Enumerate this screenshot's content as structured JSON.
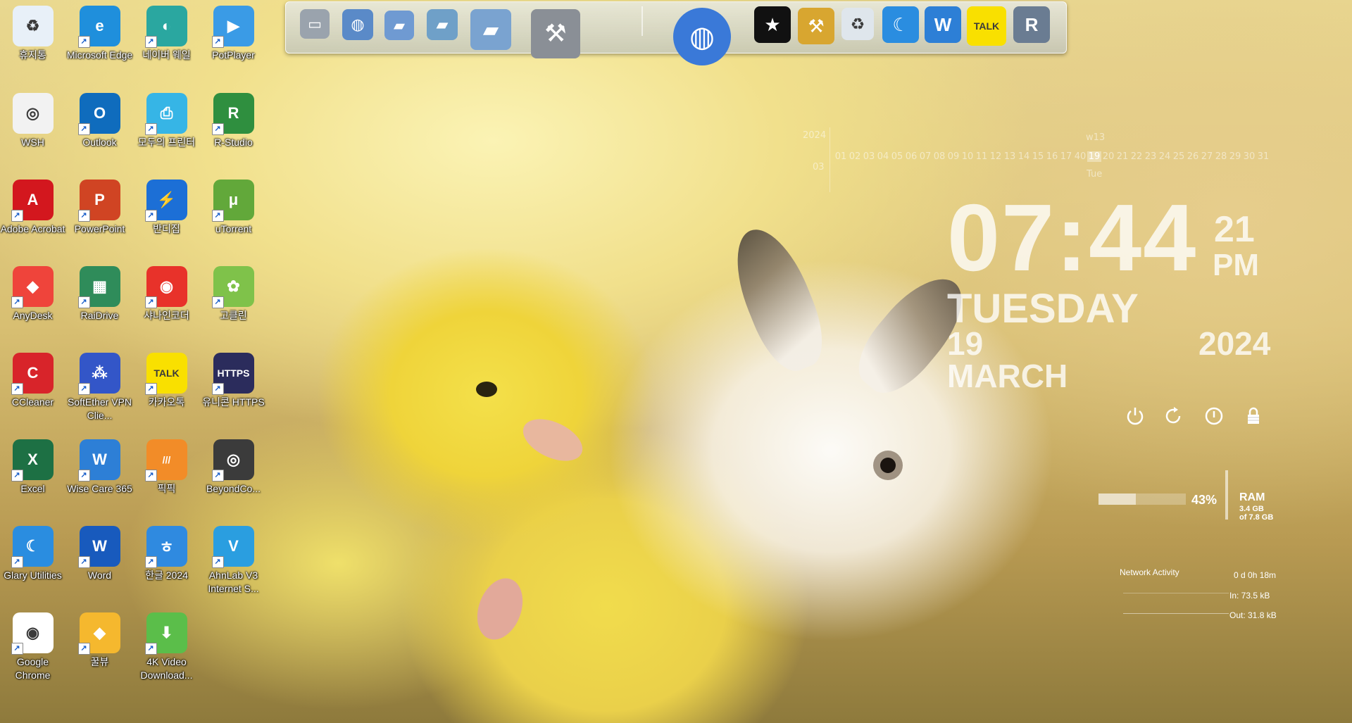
{
  "desktop": {
    "icons": [
      {
        "label": "휴지통",
        "icon": "recycle-bin-icon",
        "color": "#e8f0f8",
        "glyph": "♻"
      },
      {
        "label": "Microsoft Edge",
        "icon": "edge-icon",
        "color": "#1f8fdc",
        "glyph": "e"
      },
      {
        "label": "네이버 웨일",
        "icon": "naver-whale-icon",
        "color": "#2aa7a0",
        "glyph": "◐"
      },
      {
        "label": "PotPlayer",
        "icon": "potplayer-icon",
        "color": "#3a9be6",
        "glyph": "▶"
      },
      {
        "label": "WSH",
        "icon": "wsh-icon",
        "color": "#f2f2f2",
        "glyph": "◎"
      },
      {
        "label": "Outlook",
        "icon": "outlook-icon",
        "color": "#0f6cbd",
        "glyph": "O"
      },
      {
        "label": "모두의 프린터",
        "icon": "printer-icon",
        "color": "#36b5e6",
        "glyph": "⎙"
      },
      {
        "label": "R-Studio",
        "icon": "r-studio-icon",
        "color": "#2f8f3f",
        "glyph": "R"
      },
      {
        "label": "Adobe Acrobat",
        "icon": "acrobat-icon",
        "color": "#d3171e",
        "glyph": "A"
      },
      {
        "label": "PowerPoint",
        "icon": "powerpoint-icon",
        "color": "#d04423",
        "glyph": "P"
      },
      {
        "label": "반디집",
        "icon": "bandizip-icon",
        "color": "#1c6fd6",
        "glyph": "⚡"
      },
      {
        "label": "uTorrent",
        "icon": "utorrent-icon",
        "color": "#62a83a",
        "glyph": "μ"
      },
      {
        "label": "AnyDesk",
        "icon": "anydesk-icon",
        "color": "#ef443b",
        "glyph": "◆"
      },
      {
        "label": "RaiDrive",
        "icon": "raidrive-icon",
        "color": "#2f8c5a",
        "glyph": "▦"
      },
      {
        "label": "샤나인코더",
        "icon": "shana-encoder-icon",
        "color": "#e8322a",
        "glyph": "◉"
      },
      {
        "label": "고클린",
        "icon": "goclean-icon",
        "color": "#7fc24a",
        "glyph": "✿"
      },
      {
        "label": "CCleaner",
        "icon": "ccleaner-icon",
        "color": "#d8242a",
        "glyph": "C"
      },
      {
        "label": "SoftEther VPN Clie...",
        "icon": "softether-vpn-icon",
        "color": "#3356c8",
        "glyph": "⁂"
      },
      {
        "label": "카카오톡",
        "icon": "kakaotalk-icon",
        "color": "#f9e000",
        "glyph": "TALK"
      },
      {
        "label": "유니콘 HTTPS",
        "icon": "unicorn-https-icon",
        "color": "#2b2c5c",
        "glyph": "HTTPS"
      },
      {
        "label": "Excel",
        "icon": "excel-icon",
        "color": "#1d7044",
        "glyph": "X"
      },
      {
        "label": "Wise Care 365",
        "icon": "wise-care-icon",
        "color": "#2d7fd6",
        "glyph": "W"
      },
      {
        "label": "픽픽",
        "icon": "picpick-icon",
        "color": "#f28c28",
        "glyph": "///"
      },
      {
        "label": "BeyondCo...",
        "icon": "beyond-compare-icon",
        "color": "#3b3b3b",
        "glyph": "◎"
      },
      {
        "label": "Glary Utilities",
        "icon": "glary-utilities-icon",
        "color": "#2a8de0",
        "glyph": "☾"
      },
      {
        "label": "Word",
        "icon": "word-icon",
        "color": "#185abd",
        "glyph": "W"
      },
      {
        "label": "한글 2024",
        "icon": "hangul-icon",
        "color": "#2f8ae0",
        "glyph": "ㅎ"
      },
      {
        "label": "AhnLab V3 Internet S...",
        "icon": "ahnlab-v3-icon",
        "color": "#2a9ee0",
        "glyph": "V"
      },
      {
        "label": "Google Chrome",
        "icon": "chrome-icon",
        "color": "#ffffff",
        "glyph": "◉"
      },
      {
        "label": "꿀뷰",
        "icon": "honeyview-icon",
        "color": "#f5b82e",
        "glyph": "◆"
      },
      {
        "label": "4K Video Download...",
        "icon": "4k-video-downloader-icon",
        "color": "#5bbe4a",
        "glyph": "⬇"
      }
    ]
  },
  "dock": {
    "items": [
      {
        "name": "my-computer-icon",
        "color": "#9aa3ad",
        "glyph": "▭"
      },
      {
        "name": "network-icon",
        "color": "#5a8ac8",
        "glyph": "◍"
      },
      {
        "name": "folder-icon",
        "color": "#6f9ad2",
        "glyph": "▰"
      },
      {
        "name": "folder-images-icon",
        "color": "#6fa0c8",
        "glyph": "▰"
      },
      {
        "name": "folder-open-icon",
        "color": "#7aa3d0",
        "glyph": "▰"
      },
      {
        "name": "tools-icon",
        "color": "#8a8f96",
        "glyph": "⚒"
      },
      {
        "name": "globe-icon",
        "color": "#3a79d8",
        "glyph": "◍"
      },
      {
        "name": "tshirt-icon",
        "color": "#111111",
        "glyph": "★"
      },
      {
        "name": "hammer-wrench-icon",
        "color": "#d8a630",
        "glyph": "⚒"
      },
      {
        "name": "trash-icon",
        "color": "#dfe6ec",
        "glyph": "♻"
      },
      {
        "name": "glary-moon-icon",
        "color": "#2a8de0",
        "glyph": "☾"
      },
      {
        "name": "wise-shield-icon",
        "color": "#2d7fd6",
        "glyph": "W"
      },
      {
        "name": "kakaotalk-icon",
        "color": "#f9e000",
        "glyph": "TALK"
      },
      {
        "name": "r-drive-icon",
        "color": "#6a7c92",
        "glyph": "R"
      }
    ]
  },
  "calendar": {
    "year": "2024",
    "month": "03",
    "week": "w13",
    "weekday": "Tue",
    "today": "19",
    "days": [
      "01",
      "02",
      "03",
      "04",
      "05",
      "06",
      "07",
      "08",
      "09",
      "10",
      "11",
      "12",
      "13",
      "14",
      "15",
      "16",
      "17",
      "40",
      "19",
      "20",
      "21",
      "22",
      "23",
      "24",
      "25",
      "26",
      "27",
      "28",
      "29",
      "30",
      "31"
    ]
  },
  "clock": {
    "time": "07:44",
    "seconds": "21",
    "ampm": "PM",
    "day": "TUESDAY",
    "date": "19 MARCH",
    "year": "2024"
  },
  "power": {
    "buttons": [
      "power-icon",
      "restart-icon",
      "shutdown-icon",
      "lock-icon"
    ]
  },
  "ram": {
    "percent_used": 43,
    "percent_text": "43%",
    "label": "RAM",
    "used": "3.4 GB",
    "total": "of 7.8 GB"
  },
  "network": {
    "title": "Network Activity",
    "uptime": "0 d 0h 18m",
    "in": "In: 73.5 kB",
    "out": "Out: 31.8 kB"
  }
}
